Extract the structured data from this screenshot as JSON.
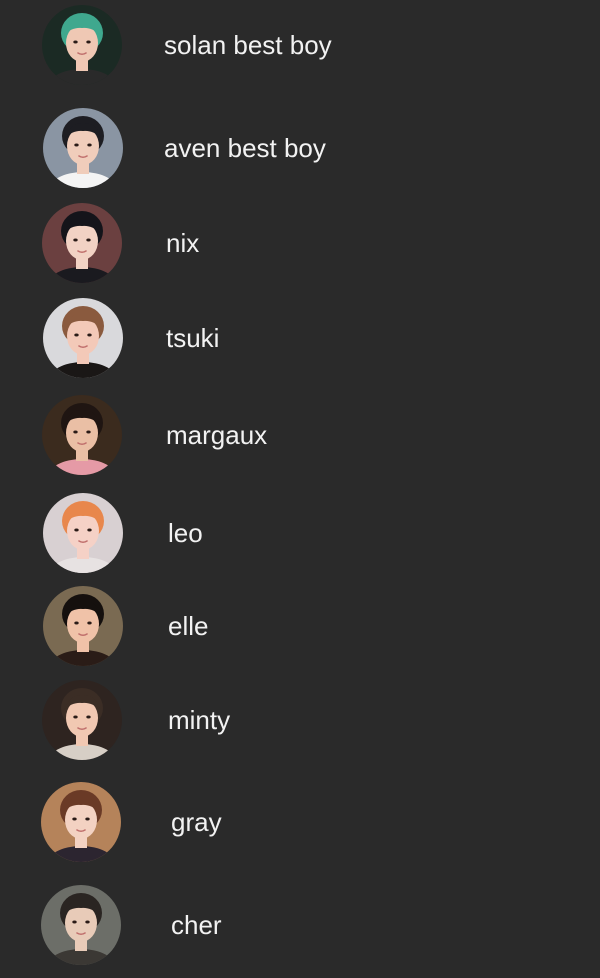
{
  "contacts": [
    {
      "name": "solan best boy",
      "avatar": {
        "bg": "#1b2a24",
        "hair": "#3fa88e",
        "skin": "#efc8b4",
        "shirt": "#2a2a2a"
      }
    },
    {
      "name": "aven best boy",
      "avatar": {
        "bg": "#8a95a3",
        "hair": "#1d1d22",
        "skin": "#f0cdbb",
        "shirt": "#f4f4f4"
      }
    },
    {
      "name": "nix",
      "avatar": {
        "bg": "#6b4040",
        "hair": "#14141a",
        "skin": "#f2d2c4",
        "shirt": "#1a1a1f"
      }
    },
    {
      "name": "tsuki",
      "avatar": {
        "bg": "#d9d9dc",
        "hair": "#8a5a3e",
        "skin": "#f3c9b8",
        "shirt": "#1a1716"
      }
    },
    {
      "name": "margaux",
      "avatar": {
        "bg": "#3b2b1e",
        "hair": "#1f1512",
        "skin": "#eabfa5",
        "shirt": "#e59aa6"
      }
    },
    {
      "name": "leo",
      "avatar": {
        "bg": "#d8d0d2",
        "hair": "#e8874c",
        "skin": "#f5d1c6",
        "shirt": "#e7e2e2"
      }
    },
    {
      "name": "elle",
      "avatar": {
        "bg": "#7a6a52",
        "hair": "#15100e",
        "skin": "#f0c2a8",
        "shirt": "#2a1c17"
      }
    },
    {
      "name": "minty",
      "avatar": {
        "bg": "#2e2420",
        "hair": "#3b2d25",
        "skin": "#f1c8b2",
        "shirt": "#d7cfc6"
      }
    },
    {
      "name": "gray",
      "avatar": {
        "bg": "#b5835a",
        "hair": "#6a3a26",
        "skin": "#f3d2c2",
        "shirt": "#2c2530"
      }
    },
    {
      "name": "cher",
      "avatar": {
        "bg": "#6c6e68",
        "hair": "#2a2522",
        "skin": "#e8cbb8",
        "shirt": "#3b3834"
      }
    }
  ]
}
